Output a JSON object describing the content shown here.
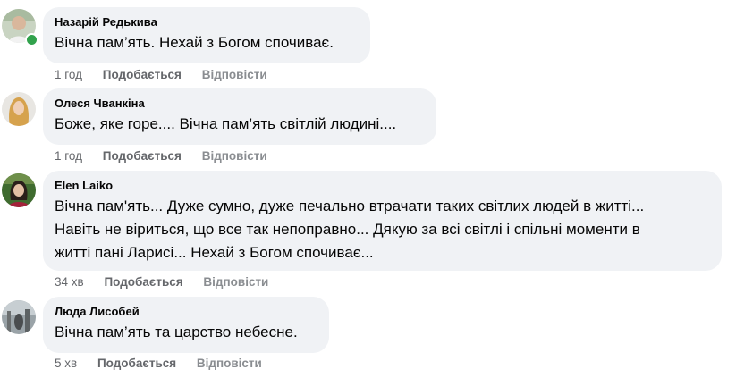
{
  "comments": [
    {
      "author": "Назарій Редькива",
      "lines": [
        "Вічна пам’ять. Нехай з Богом спочиває."
      ],
      "time": "1 год",
      "like_label": "Подобається",
      "reply_label": "Відповісти",
      "online": true
    },
    {
      "author": "Олеся Чванкіна",
      "lines": [
        "Боже, яке горе.... Вічна пам’ять світлій людині...."
      ],
      "time": "1 год",
      "like_label": "Подобається",
      "reply_label": "Відповісти",
      "online": false
    },
    {
      "author": "Elen Laiko",
      "lines": [
        "Вічна пам'ять... Дуже сумно, дуже печально втрачати таких світлих людей в житті...",
        "Навіть не віриться, що все так непоправно... Дякую за всі світлі і спільні моменти в",
        "житті пані Ларисі... Нехай з Богом спочиває..."
      ],
      "time": "34 хв",
      "like_label": "Подобається",
      "reply_label": "Відповісти",
      "online": false
    },
    {
      "author": "Люда Лисобей",
      "lines": [
        "Вічна пам’ять та царство небесне."
      ],
      "time": "5 хв",
      "like_label": "Подобається",
      "reply_label": "Відповісти",
      "online": false
    }
  ],
  "colors": {
    "bubble": "#f0f2f5",
    "meta_text": "#65676b",
    "online": "#31a24c"
  }
}
